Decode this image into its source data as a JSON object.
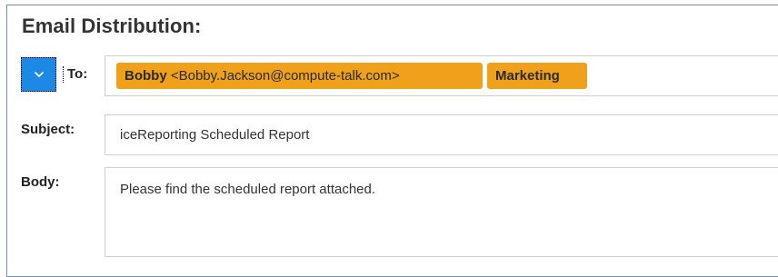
{
  "section": {
    "title": "Email Distribution:"
  },
  "to": {
    "label": "To:",
    "recipients": [
      {
        "name": "Bobby",
        "address": "<Bobby.Jackson@compute-talk.com>"
      },
      {
        "name": "Marketing"
      }
    ]
  },
  "subject": {
    "label": "Subject:",
    "value": "iceReporting Scheduled Report"
  },
  "body": {
    "label": "Body:",
    "value": "Please find the scheduled report attached."
  },
  "colors": {
    "accent": "#1e88e5",
    "chip": "#f0a11c",
    "frame_border": "#6f8fb5",
    "field_border": "#cfcfcf"
  },
  "icons": {
    "dropdown": "chevron-down-icon"
  }
}
